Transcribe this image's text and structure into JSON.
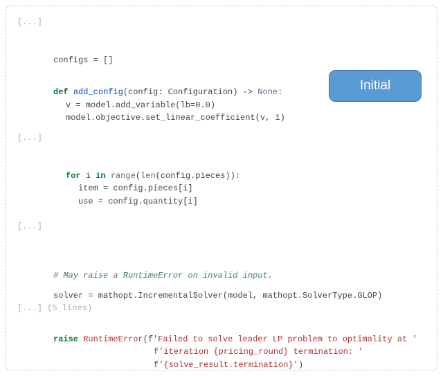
{
  "ellipsis": "[...]",
  "ellipsis_with_note": "[...] (5 lines)",
  "badge_label": "Initial",
  "code": {
    "configs_line": "configs = []",
    "kw_def": "def",
    "def_name": "add_config",
    "def_params": "(config: Configuration) -> ",
    "def_return": "None",
    "def_colon": ":",
    "v_line": "v = model.add_variable(lb=0.0)",
    "obj_line": "model.objective.set_linear_coefficient(v, 1)",
    "kw_for": "for",
    "for_var": " i ",
    "kw_in": "in",
    "for_range_pre": " ",
    "builtin_range": "range",
    "lparen": "(",
    "builtin_len": "len",
    "for_range_post": "(config.pieces)):",
    "item_line": "item = config.pieces[i]",
    "use_line": "use = config.quantity[i]",
    "comment_line": "# May raise a RuntimeError on invalid input.",
    "solver_line": "solver = mathopt.IncrementalSolver(model, mathopt.SolverType.GLOP)",
    "kw_raise": "raise",
    "raise_sp": " ",
    "runtime_error": "RuntimeError",
    "raise_open": "(f",
    "str1": "'Failed to solve leader LP problem to optimality at '",
    "cont_prefix": "f",
    "str2": "'iteration {pricing_round} termination: '",
    "str3": "'{solve_result.termination}'",
    "raise_close": ")"
  }
}
